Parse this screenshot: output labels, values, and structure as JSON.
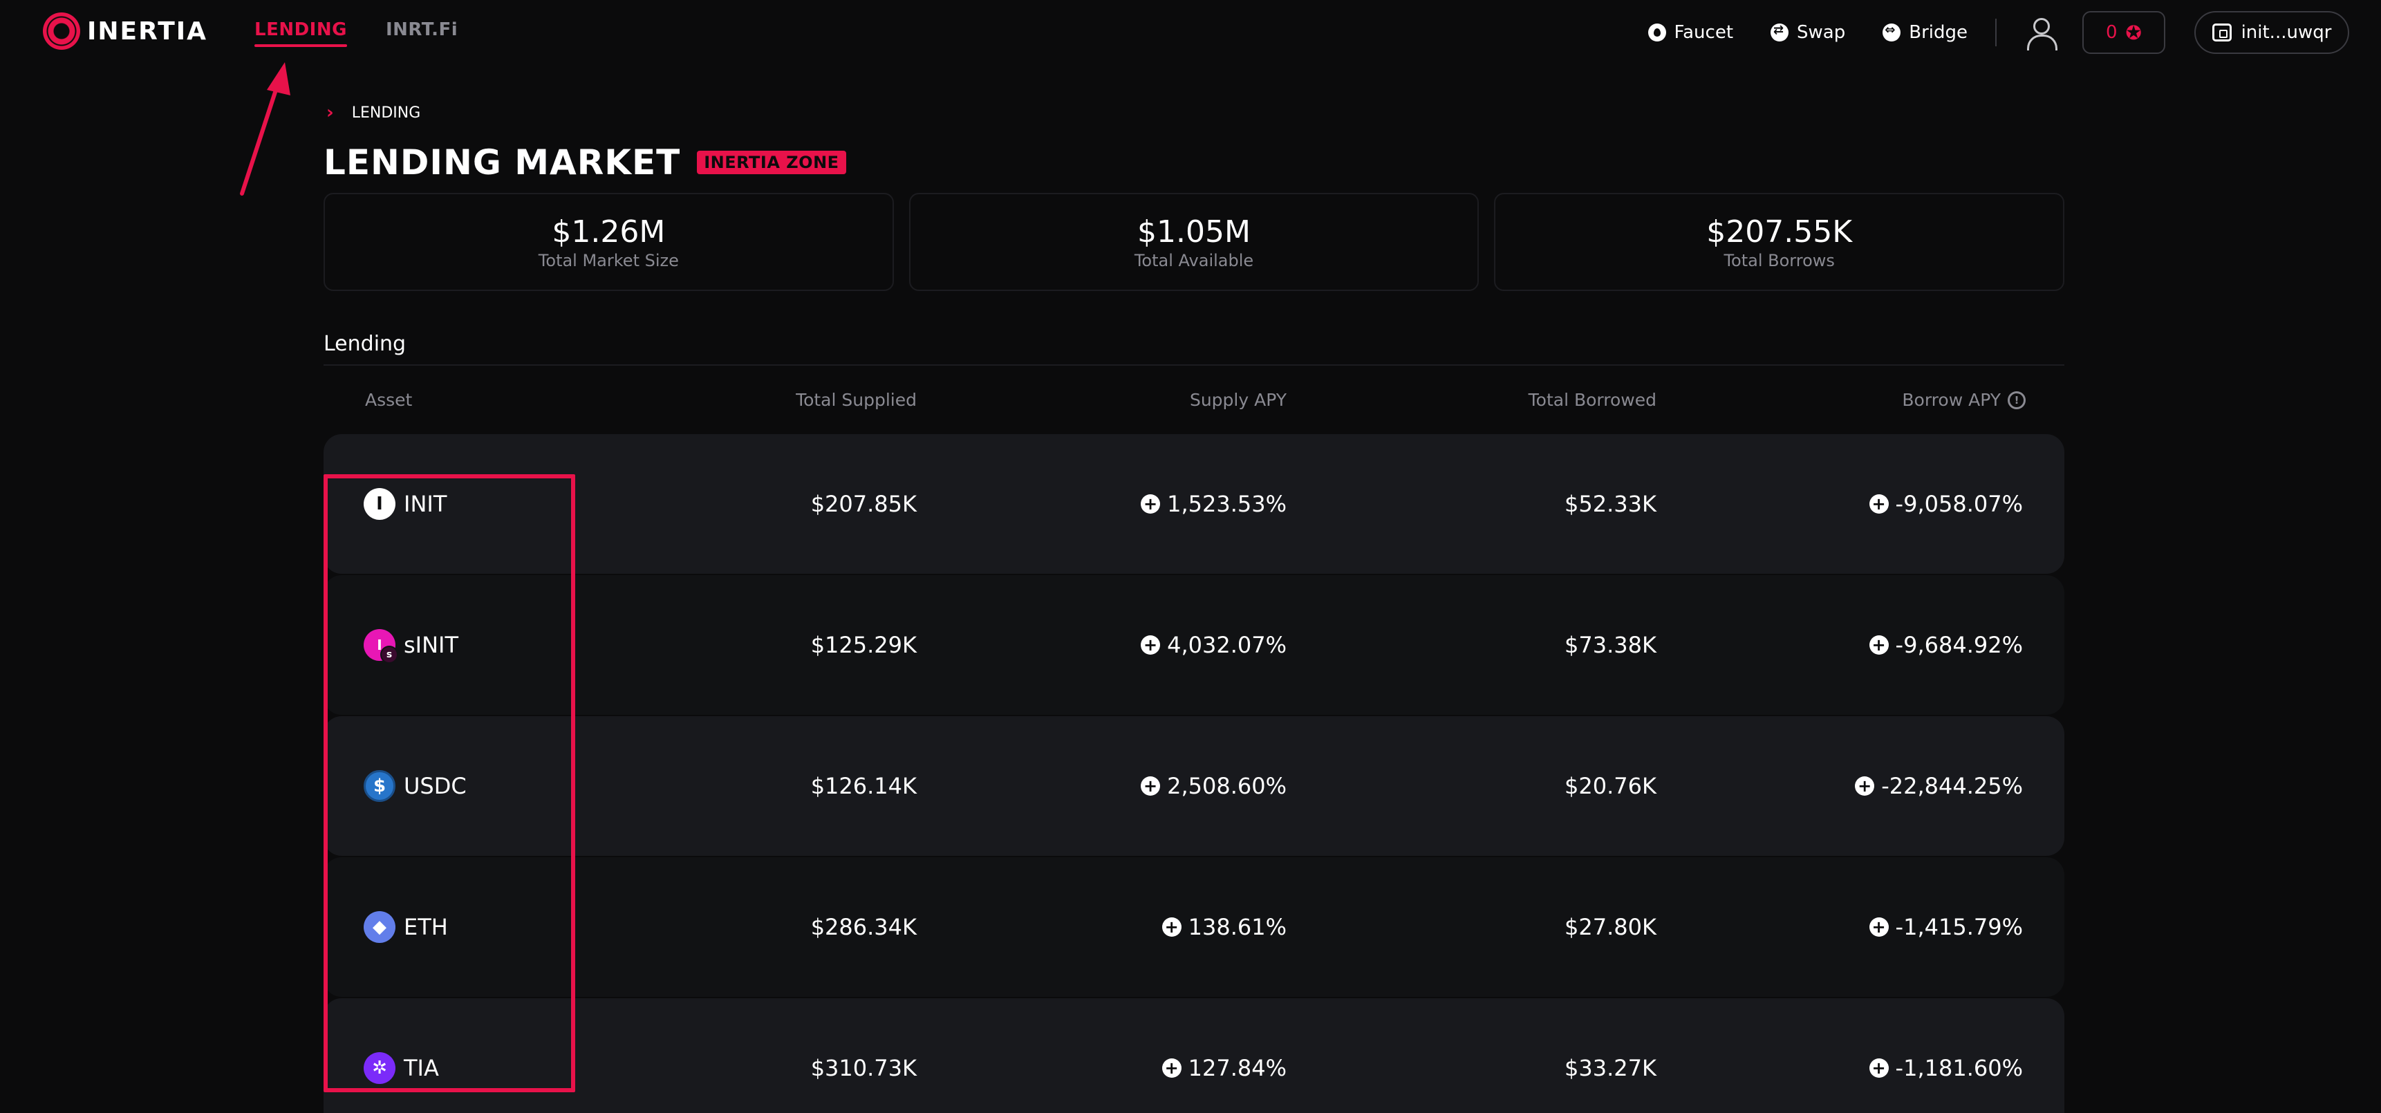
{
  "brand": {
    "name": "INERTIA",
    "accent": "#e8124a"
  },
  "nav": {
    "links": [
      {
        "label": "LENDING",
        "active": true
      },
      {
        "label": "INRT.Fi",
        "active": false
      }
    ],
    "right": {
      "faucet": "Faucet",
      "swap": "Swap",
      "bridge": "Bridge",
      "points": "0",
      "wallet": "init...uwqr"
    }
  },
  "breadcrumb": {
    "label": "LENDING"
  },
  "page": {
    "title": "LENDING MARKET",
    "badge": "INERTIA ZONE"
  },
  "stats": [
    {
      "value": "$1.26M",
      "label": "Total Market Size"
    },
    {
      "value": "$1.05M",
      "label": "Total Available"
    },
    {
      "value": "$207.55K",
      "label": "Total Borrows"
    }
  ],
  "section": {
    "title": "Lending"
  },
  "table": {
    "headers": {
      "asset": "Asset",
      "total_supplied": "Total Supplied",
      "supply_apy": "Supply APY",
      "total_borrowed": "Total Borrowed",
      "borrow_apy": "Borrow APY"
    },
    "rows": [
      {
        "asset": "INIT",
        "icon": "init-token-icon",
        "total_supplied": "$207.85K",
        "supply_apy": "1,523.53%",
        "total_borrowed": "$52.33K",
        "borrow_apy": "-9,058.07%"
      },
      {
        "asset": "sINIT",
        "icon": "sinit-token-icon",
        "total_supplied": "$125.29K",
        "supply_apy": "4,032.07%",
        "total_borrowed": "$73.38K",
        "borrow_apy": "-9,684.92%"
      },
      {
        "asset": "USDC",
        "icon": "usdc-token-icon",
        "total_supplied": "$126.14K",
        "supply_apy": "2,508.60%",
        "total_borrowed": "$20.76K",
        "borrow_apy": "-22,844.25%"
      },
      {
        "asset": "ETH",
        "icon": "eth-token-icon",
        "total_supplied": "$286.34K",
        "supply_apy": "138.61%",
        "total_borrowed": "$27.80K",
        "borrow_apy": "-1,415.79%"
      },
      {
        "asset": "TIA",
        "icon": "tia-token-icon",
        "total_supplied": "$310.73K",
        "supply_apy": "127.84%",
        "total_borrowed": "$33.27K",
        "borrow_apy": "-1,181.60%"
      }
    ]
  },
  "annotation": {
    "color": "#e8124a"
  }
}
